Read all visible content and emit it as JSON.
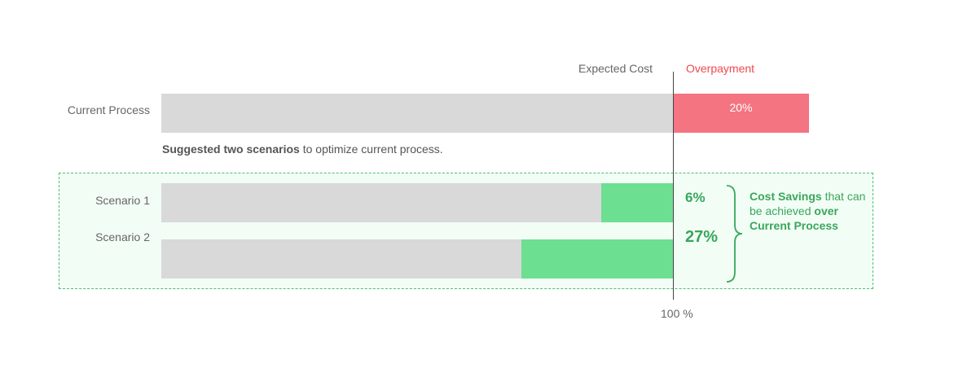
{
  "chart_data": {
    "type": "bar",
    "orientation": "horizontal",
    "header_left": "Expected Cost",
    "header_right": "Overpayment",
    "axis_label": "100 %",
    "rows": [
      {
        "label": "Current Process",
        "expected": 100,
        "overpayment": 20,
        "overpayment_label": "20%"
      },
      {
        "label": "Scenario 1",
        "value": 94,
        "savings": 6,
        "savings_label": "6%"
      },
      {
        "label": "Scenario 2",
        "value": 73,
        "savings": 27,
        "savings_label": "27%"
      }
    ],
    "note_bold": "Suggested two scenarios",
    "note_rest": " to optimize current process.",
    "savings_note": {
      "part1_bold": "Cost Savings",
      "part2": " that can be achieved ",
      "part3_bold": "over Current Process"
    }
  },
  "colors": {
    "expected": "#d9d9d9",
    "overpayment": "#f47481",
    "savings": "#6ce090",
    "savings_text": "#3aa65c"
  }
}
